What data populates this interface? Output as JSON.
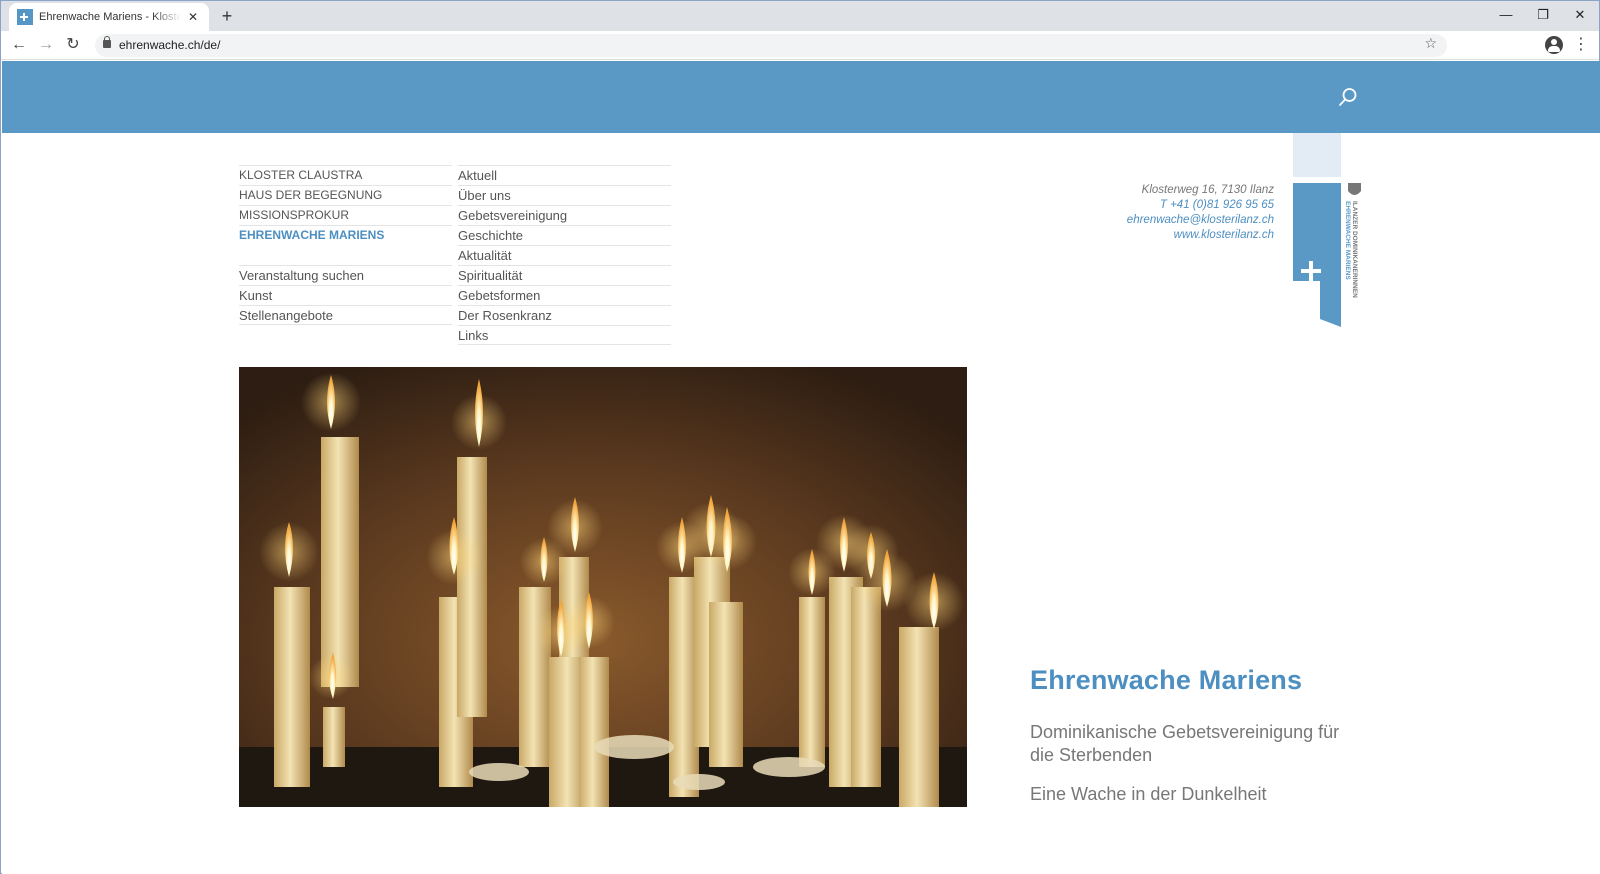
{
  "browser": {
    "tab_title": "Ehrenwache Mariens - Kloster Ilanz",
    "tab_close": "✕",
    "new_tab": "+",
    "url": "ehrenwache.ch/de/",
    "back": "←",
    "forward": "→",
    "reload": "↻",
    "star": "☆",
    "menu": "⋮",
    "minimize": "—",
    "restore": "❐",
    "close": "✕"
  },
  "menu": {
    "left": [
      {
        "label": "KLOSTER CLAUSTRA"
      },
      {
        "label": "HAUS DER BEGEGNUNG"
      },
      {
        "label": "MISSIONSPROKUR"
      },
      {
        "label": "EHRENWACHE MARIENS"
      },
      {
        "label": "Veranstaltung suchen"
      },
      {
        "label": "Kunst"
      },
      {
        "label": "Stellenangebote"
      }
    ],
    "right": [
      {
        "label": "Aktuell"
      },
      {
        "label": "Über uns"
      },
      {
        "label": "Gebetsvereinigung"
      },
      {
        "label": "Geschichte"
      },
      {
        "label": "Aktualität"
      },
      {
        "label": "Spiritualität"
      },
      {
        "label": "Gebetsformen"
      },
      {
        "label": "Der Rosenkranz"
      },
      {
        "label": "Links"
      }
    ]
  },
  "contact": {
    "address": "Klosterweg 16, 7130 Ilanz",
    "phone": "T +41 (0)81 926 95 65",
    "email": "ehrenwache@klosterilanz.ch",
    "web": "www.klosterilanz.ch"
  },
  "logo": {
    "line1": "ILANZER DOMINIKANERINNEN",
    "line2": "EHRENWACHE MARIENS"
  },
  "hero": {
    "headline": "Ehrenwache Mariens",
    "subtitle": "Dominikanische Gebetsvereinigung für die Sterbenden",
    "tagline": "Eine Wache in der Dunkelheit"
  },
  "colors": {
    "brand_blue": "#5a99c6",
    "link_blue": "#4d8fc1"
  },
  "icons": [
    "search-icon",
    "lock-icon",
    "star-icon",
    "profile-icon",
    "cross-icon"
  ]
}
